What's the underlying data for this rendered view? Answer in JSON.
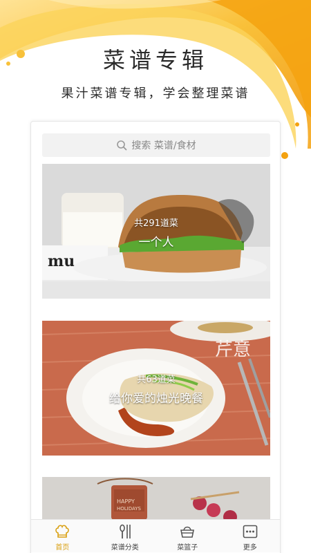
{
  "promo": {
    "title": "菜谱专辑",
    "subtitle": "果汁菜谱专辑，学会整理菜谱"
  },
  "search": {
    "icon": "search-icon",
    "placeholder": "搜索 菜谱/食材"
  },
  "albums": [
    {
      "count": "共291道菜",
      "name": "一个人"
    },
    {
      "count": "共63道菜",
      "name": "给你爱的烛光晚餐"
    },
    {
      "count": "",
      "name": ""
    }
  ],
  "tabs": [
    {
      "label": "首页",
      "icon": "chef-hat-icon",
      "active": true
    },
    {
      "label": "菜谱分类",
      "icon": "utensils-icon",
      "active": false
    },
    {
      "label": "菜篮子",
      "icon": "basket-icon",
      "active": false
    },
    {
      "label": "更多",
      "icon": "more-dots-icon",
      "active": false
    }
  ],
  "colors": {
    "accent": "#d9a012",
    "splash": "#f6b21c"
  }
}
